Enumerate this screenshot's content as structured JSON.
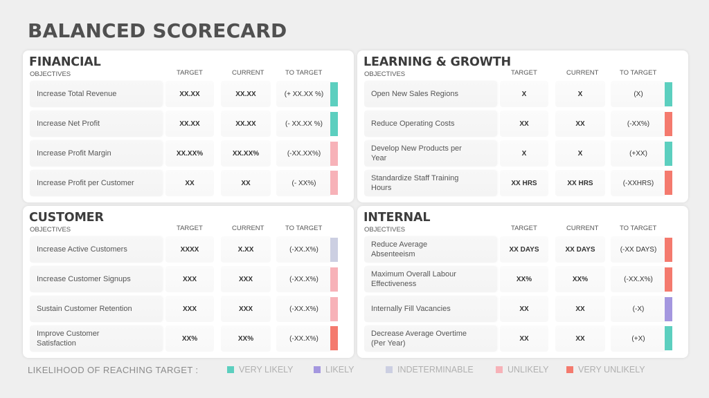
{
  "title": "BALANCED SCORECARD",
  "colors": {
    "very_likely": "#5ccfbf",
    "likely": "#a497df",
    "indeterminable": "#cccfe2",
    "unlikely": "#f7b2b8",
    "very_unlikely": "#f47a6e"
  },
  "columns": {
    "objectives": "OBJECTIVES",
    "target": "TARGET",
    "current": "CURRENT",
    "to_target": "TO TARGET"
  },
  "sections": [
    {
      "name": "FINANCIAL",
      "rows": [
        {
          "objective": "Increase Total Revenue",
          "target": "XX.XX",
          "current": "XX.XX",
          "to_target": "(+ XX.XX %)",
          "likelihood": "very_likely"
        },
        {
          "objective": "Increase Net Profit",
          "target": "XX.XX",
          "current": "XX.XX",
          "to_target": "(- XX.XX %)",
          "likelihood": "very_likely"
        },
        {
          "objective": "Increase Profit Margin",
          "target": "XX.XX%",
          "current": "XX.XX%",
          "to_target": "(-XX.XX%)",
          "likelihood": "unlikely"
        },
        {
          "objective": "Increase Profit per Customer",
          "target": "XX",
          "current": "XX",
          "to_target": "(- XX%)",
          "likelihood": "unlikely"
        }
      ]
    },
    {
      "name": "LEARNING & GROWTH",
      "rows": [
        {
          "objective": "Open New Sales Regions",
          "target": "X",
          "current": "X",
          "to_target": "(X)",
          "likelihood": "very_likely"
        },
        {
          "objective": "Reduce Operating Costs",
          "target": "XX",
          "current": "XX",
          "to_target": "(-XX%)",
          "likelihood": "very_unlikely"
        },
        {
          "objective": "Develop New Products per Year",
          "target": "X",
          "current": "X",
          "to_target": "(+XX)",
          "likelihood": "very_likely"
        },
        {
          "objective": "Standardize Staff Training Hours",
          "target": "XX HRS",
          "current": "XX HRS",
          "to_target": "(-XXHRS)",
          "likelihood": "very_unlikely"
        }
      ]
    },
    {
      "name": "CUSTOMER",
      "rows": [
        {
          "objective": "Increase Active Customers",
          "target": "XXXX",
          "current": "X.XX",
          "to_target": "(-XX.X%)",
          "likelihood": "indeterminable"
        },
        {
          "objective": "Increase Customer Signups",
          "target": "XXX",
          "current": "XXX",
          "to_target": "(-XX.X%)",
          "likelihood": "unlikely"
        },
        {
          "objective": "Sustain Customer Retention",
          "target": "XXX",
          "current": "XXX",
          "to_target": "(-XX.X%)",
          "likelihood": "unlikely"
        },
        {
          "objective": "Improve Customer Satisfaction",
          "target": "XX%",
          "current": "XX%",
          "to_target": "(-XX.X%)",
          "likelihood": "very_unlikely"
        }
      ]
    },
    {
      "name": "INTERNAL",
      "rows": [
        {
          "objective": "Reduce Average Absenteeism",
          "target": "XX DAYS",
          "current": "XX DAYS",
          "to_target": "(-XX DAYS)",
          "likelihood": "very_unlikely"
        },
        {
          "objective": "Maximum Overall Labour Effectiveness",
          "target": "XX%",
          "current": "XX%",
          "to_target": "(-XX.X%)",
          "likelihood": "very_unlikely"
        },
        {
          "objective": "Internally Fill Vacancies",
          "target": "XX",
          "current": "XX",
          "to_target": "(-X)",
          "likelihood": "likely"
        },
        {
          "objective": "Decrease Average Overtime (Per Year)",
          "target": "XX",
          "current": "XX",
          "to_target": "(+X)",
          "likelihood": "very_likely"
        }
      ]
    }
  ],
  "legend": {
    "label": "LIKELIHOOD OF REACHING TARGET :",
    "items": [
      {
        "key": "very_likely",
        "label": "VERY LIKELY"
      },
      {
        "key": "likely",
        "label": "LIKELY"
      },
      {
        "key": "indeterminable",
        "label": "INDETERMINABLE"
      },
      {
        "key": "unlikely",
        "label": "UNLIKELY"
      },
      {
        "key": "very_unlikely",
        "label": "VERY UNLIKELY"
      }
    ]
  }
}
